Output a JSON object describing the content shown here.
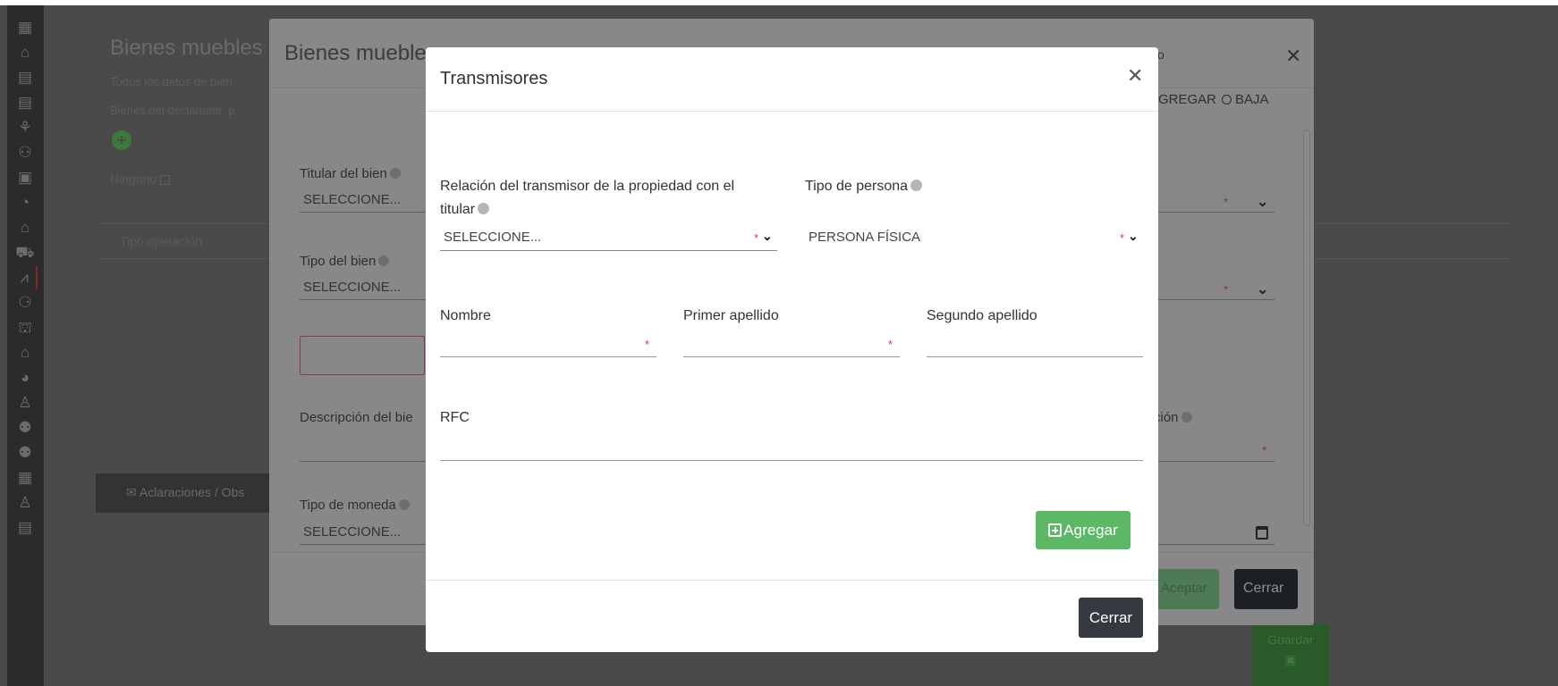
{
  "background_page": {
    "title": "Bienes muebles",
    "subtitle_1": "Todos los datos de bien",
    "subtitle_2": "Bienes del declarante, p",
    "ninguno_label": "Ninguno",
    "tipo_operacion_header": "Tipo operación",
    "aclaraciones_button": "Aclaraciones / Obs",
    "guardar_button": "Guardar"
  },
  "mid_dialog": {
    "title": "Bienes muebles",
    "partial_header_text": "o",
    "radio_agregar": "AGREGAR",
    "radio_baja": "BAJA",
    "titular_label": "Titular del bien",
    "titular_value": "SELECCIONE...",
    "tipo_bien_label": "Tipo del bien",
    "tipo_bien_value": "SELECCIONE...",
    "descripcion_label": "Descripción del bie",
    "ubicacion_partial_label": "ción",
    "tipo_moneda_label": "Tipo de moneda",
    "tipo_moneda_value": "SELECCIONE...",
    "aceptar_button": "Aceptar",
    "cerrar_button": "Cerrar"
  },
  "modal": {
    "title": "Transmisores",
    "relacion_label_line1": "Relación del transmisor de la propiedad con el",
    "relacion_label_line2": "titular",
    "relacion_value": "SELECCIONE...",
    "tipo_persona_label": "Tipo de persona",
    "tipo_persona_value": "PERSONA FÍSICA",
    "nombre_label": "Nombre",
    "primer_apellido_label": "Primer apellido",
    "segundo_apellido_label": "Segundo apellido",
    "rfc_label": "RFC",
    "agregar_button": "Agregar",
    "cerrar_button": "Cerrar"
  },
  "colors": {
    "accent_green": "#5cb865",
    "dark_button": "#343a40",
    "required_red": "#e0403a"
  }
}
